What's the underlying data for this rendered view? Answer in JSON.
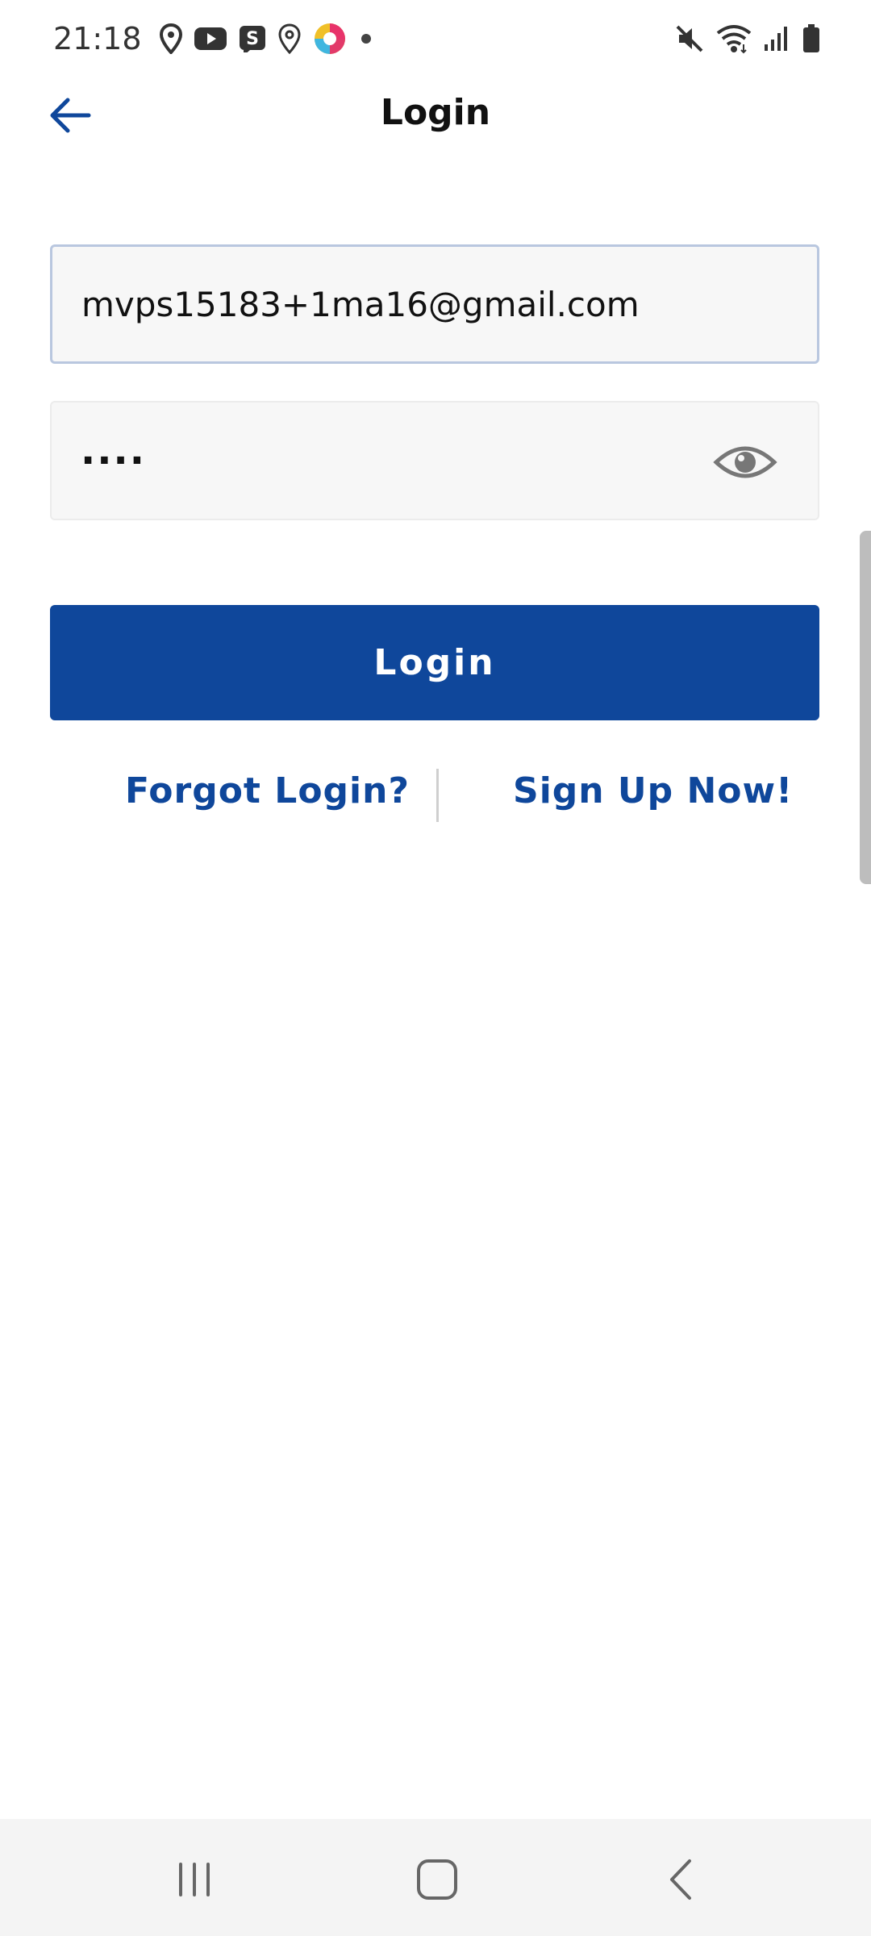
{
  "status_bar": {
    "time": "21:18",
    "left_icons": [
      "location-icon",
      "youtube-icon",
      "s-app-icon",
      "map-pin-icon",
      "color-app-icon",
      "dot-icon"
    ],
    "right_icons": [
      "mute-icon",
      "wifi-icon",
      "signal-icon",
      "battery-icon"
    ],
    "s_letter": "S"
  },
  "header": {
    "title": "Login",
    "back_icon": "arrow-left-icon"
  },
  "form": {
    "email_value": "mvps15183+1ma16@gmail.com",
    "password_masked": "····",
    "eye_icon": "eye-icon",
    "login_label": "Login"
  },
  "links": {
    "forgot": "Forgot Login?",
    "signup": "Sign Up Now!"
  },
  "nav": {
    "recents_icon": "recents-icon",
    "home_icon": "home-icon",
    "back_icon": "back-chevron-icon"
  },
  "colors": {
    "accent": "#0f479b",
    "field_bg": "#f7f7f7",
    "nav_bg": "#f4f4f4"
  }
}
